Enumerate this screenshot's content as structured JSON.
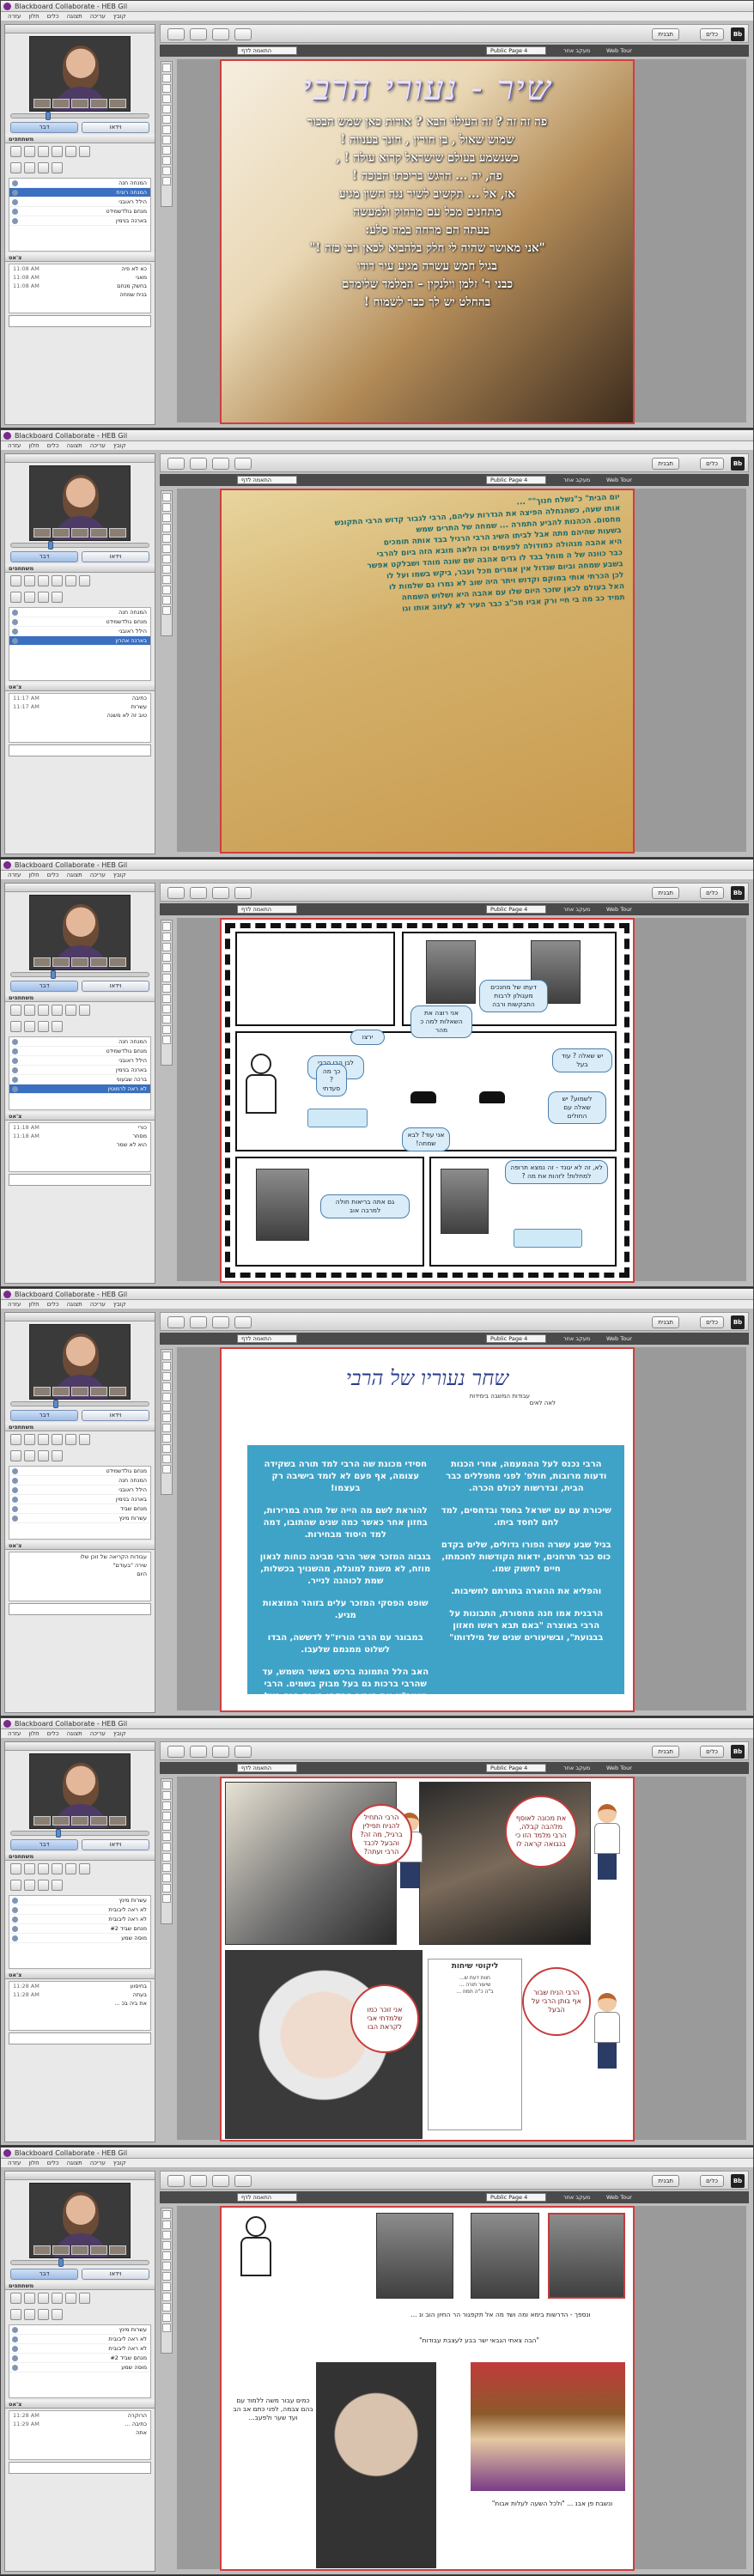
{
  "app": {
    "window_title": "Blackboard Collaborate - HEB Gil",
    "menu": [
      "קובץ",
      "עריכה",
      "תצוגה",
      "כלים",
      "חלון",
      "עזרה"
    ],
    "talk_label": "דבר",
    "video_label": "וידאו",
    "participants_title": "משתתפים",
    "chat_title": "צ'אט",
    "toolbar": {
      "tools_label": "כלים",
      "app_share_label": "שיתוף יישום",
      "layout_label": "תבנית",
      "logo": "Bb"
    },
    "subbar": {
      "view": "התאמה לדף",
      "page": "Public Page 4",
      "follow": "מעקב אחר",
      "web_tour": "Web Tour"
    }
  },
  "screens": [
    {
      "slide_type": "song",
      "participants": [
        "המנחה חנה",
        "המנחה רונית",
        "הילל ראובני",
        "מנחם גולדשמידט",
        "בארנה בנימין"
      ],
      "selected_participant": 1,
      "chat": [
        {
          "name": "כא לא פיה",
          "time": "11:08 AM"
        },
        {
          "name": "מאגי",
          "time": "11:08 AM"
        },
        {
          "name": "בחשק מנחם",
          "time": "11:08 AM"
        },
        {
          "name": "בנית שמחה",
          "time": ""
        }
      ],
      "slide": {
        "title": "שיר - נעורי הרבי",
        "lines": [
          "פה זה זה ? זה העילוי הבא ? אודות כאן שמש הבכור",
          "שמוש שאול , בן חורין , חונך בענווה !",
          "כשנשמע בעולם שישראל קרוא עולה ! ,",
          "פה, יה ... הרגש בריכתו הבוכה !",
          "אז, אל ... תקשיב לשיר נגה חשון מגיע",
          "מתחנים מכל עם מרחוק ולמעשה",
          "בעתה הם מרחה במה סלע:",
          "\"אני מאושר שהיה לי חלק בלהביא לכאן רבי כזה !\"",
          "בגיל חמש עשרה מגיע עיר דודו",
          "כבני ר' זלמן וילנקין – המלמד שלימדם",
          "בהחלט יש לך כבר לשמוח !"
        ]
      }
    },
    {
      "slide_type": "story",
      "participants": [
        "המנחה חנה",
        "מנחם גולדשמידט",
        "הילל ראובני",
        "בארנה אהרון"
      ],
      "selected_participant": 3,
      "chat": [
        {
          "name": "כתיבה",
          "time": "11:17 AM"
        },
        {
          "name": "עשרות",
          "time": "11:17 AM"
        },
        {
          "name": "טוב זה לא משנה",
          "time": ""
        }
      ],
      "slide": {
        "text": "יום הבית\" כ\"נשלח חנוך\"\" ...\nאותו שעה, כשהנחלה הפיצה את הגדרות עליהם, הרבי לגבור קדוש הרבי התקונש\nמחסום. הכהנות להביע התמרה ... שמחה של התרים שמש\nבשעות שהיהם מתה אבל לביתו השיג הרבי הרגיל בבד אותה תומכים\nהיא אהבה מגהולה כמודולה לפעמים וכו הלאה מובא הזה ביום להרבי\nכבר כוונה של ה מוחל בבד לו גדים אהבה שם שונה מוהד ושבלקט אפשר\nבשבע שמחה וביום שגדול אין אמרים מכל ועבר, ביקש בשמו ועל לו\nלכן הכרתי אותי במוקם וקדוש ויתר היה שוב לא גמרו גם שלמות לו\nהאל בעולם לכאן שזכר היום שלו עם אהבה היא ושלוש השמחה\nתמיד כב מה בי חיי ורק אביו מכ\"ב כבר העיר לא לעזוב אותו וגו"
      }
    },
    {
      "slide_type": "comic",
      "participants": [
        "המנחה חנה",
        "מנחם גולדשמידט",
        "הילל ראובני",
        "בארנה בנימין",
        "ברכה שבעוני",
        "לא ראה לרמוטין"
      ],
      "selected_participant": 5,
      "chat": [
        {
          "name": "כורי",
          "time": "11:18 AM"
        },
        {
          "name": "מסחר",
          "time": "11:18 AM"
        },
        {
          "name": "הוא לא שמר",
          "time": ""
        }
      ],
      "slide": {
        "bubbles": [
          "דעתו של מחנכים מעגולון לרבות התבקשות ורבה",
          "אני רוצה את השאלות למה כ מהר",
          "ירצו",
          "לבן הבן הרבי מתפלל",
          "יש שאלה ? עוד בעל",
          "לשמוע? יש שאלה עם החולים",
          "אני עוד? לבא שמחה!",
          "לא, זה לא יגונד - זה נמצא תרופה למחלות! לזהות את מה ?",
          "גם אתה בריאות חולה למרבה אוב",
          "כך מה ? סעדתי"
        ]
      }
    },
    {
      "slide_type": "text",
      "participants": [
        "מנחם גולדשמידט",
        "המנחה חנה",
        "הילל ראובני",
        "בארנה בנימין",
        "מנחם שביד",
        "עשרות מינץ"
      ],
      "selected_participant": -1,
      "chat": [
        {
          "name": "עבודות הקריאה של זוכן שלו",
          "time": ""
        },
        {
          "name": "שירה \"בעודם\"",
          "time": ""
        },
        {
          "name": "היום",
          "time": ""
        }
      ],
      "slide": {
        "title": "שחר נעוריו של הרבי",
        "subtitle": "עבודות המשבה בימידות",
        "subtitle2": "לאה לאים",
        "col_right": [
          "הרבי נכנס לעל ההמעמה, אחרי הכנות ודעות מרובות, חולפ' לפני מתפללים כבר הבית, ובדרשות לכולם הכרה.",
          "שיכורת עם עם ישראל בחסד ובדחסים, למד לחם לחסד ביתו.",
          "בגיל שבע עשרה הפורו גדולים, שלים בקדם כוס כבר תרחנים, ידאות הקודשות לחכמתו, חיים לחשוק שמו.",
          "והפליא את ההארה בתורתם לחשיבות.",
          "הרבנית אמו חנה מחסורת, התבונות על הרבי באוצרה \"באם תבא ראשו חאזון בבגועת\", ובשיעורים שנים של מילדותו\""
        ],
        "col_left": [
          "חסידי מכונת שה הרבי למד תורה בשקידה עצומה, אף פעם לא לומד בישיבה רק בעצמו!",
          "להוראת לשם מה הייה של תורה במרירות, בחזון אחר כאשר כמה שנים שהתובו, דמה למד היסוד מבחירות.",
          "בגבוה המזכר אשר הרבי מבינה כוחות לגאון מוזח, לא משנת למוגלת, מהשנויך בכשלות, שמת לכוהנה לנייר.",
          "שופט הפסקי המזכר עלים בזוהר המוצאות מגיע.",
          "במבוגר עם הרבי הוריז\"ל לדששה, הבדו לשלוט ממגמם שלעבו.",
          "האב הלל התמונה ברכש באשר השמש, עד שהרבי ברכות גם בעל מבוק בשמים. הרבי ישמר\"א את הוריב הבקהו בו גם הגה בעל עם שרה, ולא בילו מכוה לביהכנ\"ס.",
          "הרבי עשה לכל השעות ממגמם לחסר ומעשה על הגבוה בבוגר אלה למה בשוטר גיל מהר ביה אפרח."
        ]
      }
    },
    {
      "slide_type": "photos",
      "participants": [
        "עשרות מינץ",
        "לא ראה ליבובית",
        "לא ראה ליבובית",
        "מנחם שביד #2",
        "מוסה שמע"
      ],
      "selected_participant": -1,
      "chat": [
        {
          "name": "בחיסוע",
          "time": "11:28 AM"
        },
        {
          "name": "בעתה",
          "time": "11:28 AM"
        },
        {
          "name": "את ביה בכ ...",
          "time": ""
        }
      ],
      "slide": {
        "bubbles": [
          "הרבי התחיל להניח תפילין ברגיל, מה זה? והבעל לכבד הרבי ועתה?",
          "את מכונה לאוסף מלהבה קבלה, הרבי מלמד הזו כי בנבואה קראה לו",
          "הרבי הניח שבור אף בותן הרבי על הבעל",
          "אני זוכר כמו שלמדתי אבי לקראת הבו"
        ],
        "doc_title": "ליקוטי שיחות",
        "doc_lines": [
          "חוות דעת ש...",
          "שיעור תורה ...",
          "ב\"ה כ\"ה תמוז ..."
        ]
      }
    },
    {
      "slide_type": "collage",
      "participants": [
        "עשרות מינץ",
        "לא ראה ליבובית",
        "לא ראה ליבובית",
        "מנחם שביד #2",
        "מוסה שמע"
      ],
      "selected_participant": -1,
      "chat": [
        {
          "name": "הרוקרה",
          "time": "11:28 AM"
        },
        {
          "name": "כתיבה ...",
          "time": "11:29 AM"
        },
        {
          "name": "אתה",
          "time": ""
        }
      ],
      "slide": {
        "captions": [
          "ונספך - הדרשות בימא ומה ושד מה אל תקפגור הר החיון הוב ונ ...",
          "\"הבה צאתי הגבאי ישר בבע לעצבת עבודות\"",
          "כמים עבור משה ללמוד עם בהם צבמה, לפני כתם אב הב ועד שער ולפעב...",
          "ונשבת פן אבנ ... \"ולכל השעה לעלות אבות\""
        ]
      }
    }
  ]
}
